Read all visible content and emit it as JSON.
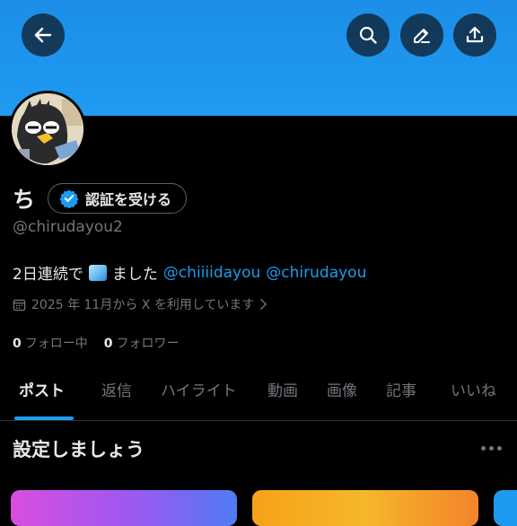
{
  "colors": {
    "banner": "#1f9bf0",
    "accent": "#1d9bf0",
    "muted": "#71767b",
    "text": "#e7e9ea",
    "background": "#000000"
  },
  "header": {
    "back_icon": "arrow-left-icon",
    "search_icon": "search-icon",
    "edit_icon": "pencil-icon",
    "share_icon": "share-upload-icon"
  },
  "profile": {
    "display_name": "ち",
    "verify_button_label": "認証を受ける",
    "verify_icon": "verified-badge-icon",
    "handle": "@chirudayou2",
    "bio_prefix": "2日連続で",
    "bio_emoji": "ice-cube-emoji",
    "bio_middle": "ました",
    "bio_mentions": [
      "@chiiiidayou",
      "@chirudayou"
    ],
    "joined_text": "2025 年 11月から X を利用しています",
    "following_count": "0",
    "following_label": "フォロー中",
    "followers_count": "0",
    "followers_label": "フォロワー"
  },
  "tabs": [
    "ポスト",
    "返信",
    "ハイライト",
    "動画",
    "画像",
    "記事",
    "いいね"
  ],
  "active_tab": "ポスト",
  "setup_section": {
    "title": "設定しましょう",
    "more_icon": "more-horizontal-icon"
  }
}
